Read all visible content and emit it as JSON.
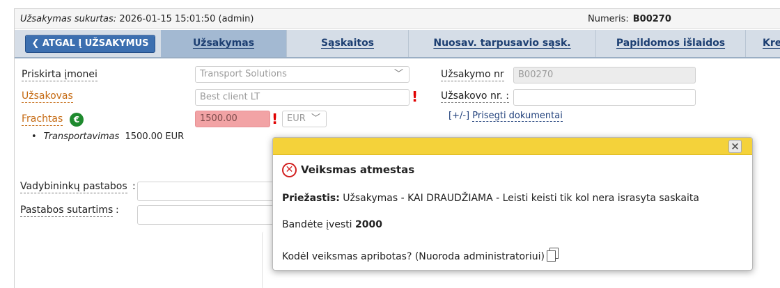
{
  "header": {
    "created_label": "Užsakymas sukurtas:",
    "created_value": "2026-01-15 15:01:50 (admin)",
    "number_label": "Numeris:",
    "number_value": "B00270"
  },
  "tabs": {
    "back_label": "❮ ATGAL Į UŽSAKYMUS",
    "items": [
      {
        "label": "Užsakymas"
      },
      {
        "label": "Sąskaitos"
      },
      {
        "label": "Nuosav. tarpusavio sąsk."
      },
      {
        "label": "Papildomos išlaidos"
      },
      {
        "label": "Kre"
      }
    ]
  },
  "form": {
    "assigned_company_label": "Priskirta įmonei",
    "assigned_company_value": "Transport Solutions",
    "customer_label": "Užsakovas",
    "customer_value": "Best client LT",
    "freight_label": "Frachtas",
    "euro_symbol": "€",
    "freight_value": "1500.00",
    "currency_value": "EUR",
    "order_nr_label": "Užsakymo nr",
    "order_nr_value": "B00270",
    "customer_nr_label": "Užsakovo nr. :",
    "customer_nr_value": "",
    "attach_prefix": "[+/-]",
    "attach_link": "Prisegti dokumentai",
    "transport_label": "Transportavimas",
    "transport_value": "1500.00 EUR",
    "managers_notes_label": "Vadybininkų pastabos",
    "contract_notes_label": "Pastabos sutartims",
    "colon": ":"
  },
  "modal": {
    "close_glyph": "×",
    "title": "Veiksmas atmestas",
    "reason_label": "Priežastis:",
    "reason_text": "Užsakymas - KAI DRAUDŽIAMA - Leisti keisti tik kol nera israsyta saskaita",
    "tried_label": "Bandėte įvesti",
    "tried_value": "2000",
    "why_text": "Kodėl veiksmas apribotas? (Nuoroda administratoriui)"
  },
  "colors": {
    "accent": "#3c6fb0",
    "error": "#e00000",
    "modal_bar": "#f4d23a",
    "label_orange": "#c56a12"
  }
}
